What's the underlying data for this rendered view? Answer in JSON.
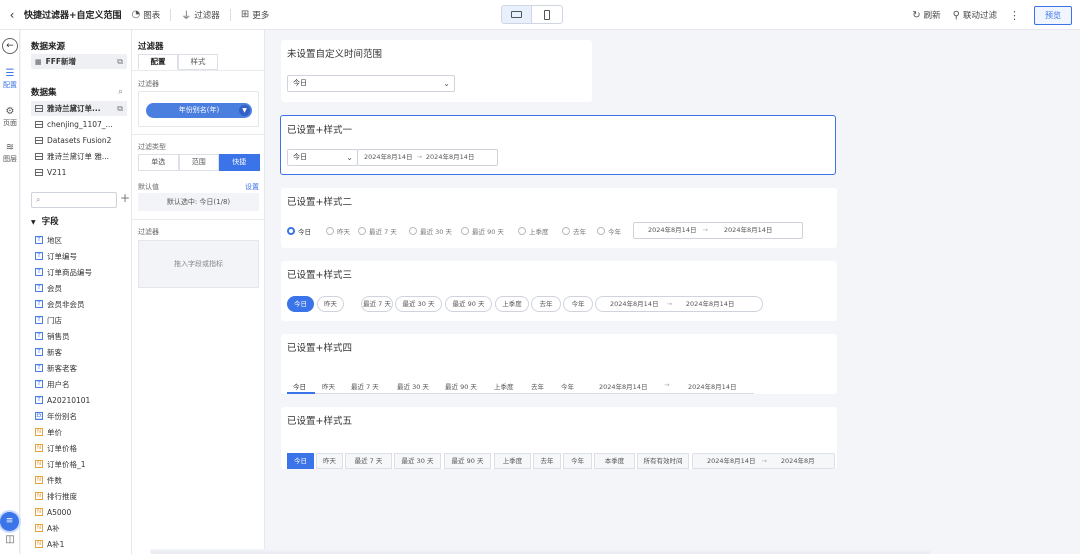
{
  "toolbar": {
    "title": "快捷过滤器+自定义范围",
    "chart": "图表",
    "filter": "过滤器",
    "more": "更多",
    "refresh": "刷新",
    "linked_filter": "联动过滤",
    "preview": "预览"
  },
  "rail": {
    "config": "配置",
    "page": "页面",
    "layer": "图层"
  },
  "data_panel": {
    "source_heading": "数据来源",
    "source": "FFF新增",
    "datasets_heading": "数据集",
    "datasets": [
      "雅诗兰黛订单...",
      "chenjing_1107_...",
      "Datasets Fusion2",
      "雅诗兰黛订单 雅...",
      "V211"
    ],
    "fields_heading": "字段",
    "fields": [
      {
        "name": "地区",
        "type": "T"
      },
      {
        "name": "订单编号",
        "type": "T"
      },
      {
        "name": "订单商品编号",
        "type": "T"
      },
      {
        "name": "会员",
        "type": "T"
      },
      {
        "name": "会员非会员",
        "type": "T"
      },
      {
        "name": "门店",
        "type": "T"
      },
      {
        "name": "销售员",
        "type": "T"
      },
      {
        "name": "新客",
        "type": "T"
      },
      {
        "name": "新客老客",
        "type": "T"
      },
      {
        "name": "用户名",
        "type": "T"
      },
      {
        "name": "A20210101",
        "type": "T"
      },
      {
        "name": "年份别名",
        "type": "D"
      },
      {
        "name": "单价",
        "type": "N"
      },
      {
        "name": "订单价格",
        "type": "N"
      },
      {
        "name": "订单价格_1",
        "type": "N"
      },
      {
        "name": "件数",
        "type": "N"
      },
      {
        "name": "排行推度",
        "type": "N"
      },
      {
        "name": "A5000",
        "type": "N"
      },
      {
        "name": "A补",
        "type": "N"
      },
      {
        "name": "A补1",
        "type": "N"
      }
    ]
  },
  "config_panel": {
    "heading": "过滤器",
    "tabs": [
      "配置",
      "样式"
    ],
    "filter_label": "过滤器",
    "filter_field": "年份别名(年)",
    "type_label": "过滤类型",
    "types": [
      "单选",
      "范围",
      "快捷"
    ],
    "active_type": "快捷",
    "default_label": "默认值",
    "set_link": "设置",
    "default_value": "默认选中: 今日(1/8)",
    "filter_label_2": "过滤器",
    "drop_hint": "拖入字段或指标"
  },
  "cards": {
    "c0": {
      "title": "未设置自定义时间范围",
      "select": "今日"
    },
    "c1": {
      "title": "已设置+样式一",
      "select": "今日",
      "from": "2024年8月14日",
      "to": "2024年8月14日"
    },
    "c2": {
      "title": "已设置+样式二",
      "options": [
        "今日",
        "昨天",
        "最近 7 天",
        "最近 30 天",
        "最近 90 天",
        "上季度",
        "去年",
        "今年"
      ],
      "from": "2024年8月14日",
      "to": "2024年8月14日"
    },
    "c3": {
      "title": "已设置+样式三",
      "options": [
        "今日",
        "昨天",
        "最近 7 天",
        "最近 30 天",
        "最近 90 天",
        "上季度",
        "去年",
        "今年"
      ],
      "from": "2024年8月14日",
      "to": "2024年8月14日"
    },
    "c4": {
      "title": "已设置+样式四",
      "options": [
        "今日",
        "昨天",
        "最近 7 天",
        "最近 30 天",
        "最近 90 天",
        "上季度",
        "去年",
        "今年"
      ],
      "from": "2024年8月14日",
      "to": "2024年8月14日"
    },
    "c5": {
      "title": "已设置+样式五",
      "options": [
        "今日",
        "昨天",
        "最近 7 天",
        "最近 30 天",
        "最近 90 天",
        "上季度",
        "去年",
        "今年",
        "本季度",
        "所有有效时间"
      ],
      "from": "2024年8月14日",
      "to": "2024年8月"
    }
  },
  "colors": {
    "accent": "#3b73e8",
    "text_field": "#4a7fe0",
    "num_field": "#e8a13b"
  }
}
